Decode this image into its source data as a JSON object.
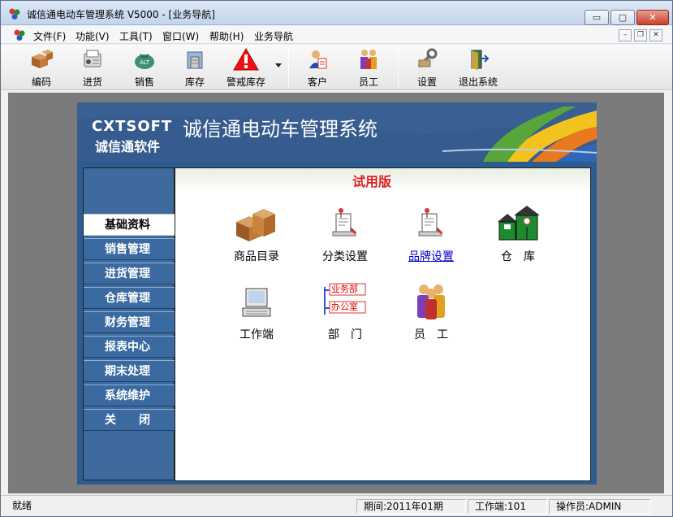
{
  "window": {
    "title": "诚信通电动车管理系统 V5000 - [业务导航]",
    "close_glyph": "✕",
    "minimize_glyph": "▭",
    "maximize_glyph": "▢"
  },
  "menubar": {
    "items": [
      "文件(F)",
      "功能(V)",
      "工具(T)",
      "窗口(W)",
      "帮助(H)",
      "业务导航"
    ],
    "mdi_min": "–",
    "mdi_restore": "❐",
    "mdi_close": "✕"
  },
  "toolbar": {
    "buttons": [
      {
        "label": "编码",
        "icon": "boxes-icon"
      },
      {
        "label": "进货",
        "icon": "stock-in-icon"
      },
      {
        "label": "销售",
        "icon": "money-bag-icon"
      },
      {
        "label": "库存",
        "icon": "warehouse-icon"
      },
      {
        "label": "警戒库存",
        "icon": "warning-icon"
      },
      {
        "label": "客户",
        "icon": "customer-icon"
      },
      {
        "label": "员工",
        "icon": "staff-icon"
      },
      {
        "label": "设置",
        "icon": "tools-icon"
      },
      {
        "label": "退出系统",
        "icon": "exit-door-icon"
      }
    ]
  },
  "banner": {
    "logo_en": "CXTSOFT",
    "logo_cn": "诚信通软件",
    "system_title": "诚信通电动车管理系统"
  },
  "nav": {
    "items": [
      "基础资料",
      "销售管理",
      "进货管理",
      "仓库管理",
      "财务管理",
      "报表中心",
      "期末处理",
      "系统维护",
      "关　　闭"
    ],
    "active_index": 0
  },
  "content": {
    "edition": "试用版",
    "items": [
      {
        "label": "商品目录",
        "icon": "product-catalog-icon"
      },
      {
        "label": "分类设置",
        "icon": "category-settings-icon"
      },
      {
        "label": "品牌设置",
        "icon": "brand-settings-icon"
      },
      {
        "label": "仓　库",
        "icon": "warehouse-houses-icon"
      },
      {
        "label": "工作端",
        "icon": "workstation-icon"
      },
      {
        "label": "部　门",
        "icon": "department-icon"
      },
      {
        "label": "员　工",
        "icon": "employees-icon"
      }
    ],
    "dept_chart": {
      "node1": "业务部",
      "node2": "办公室"
    }
  },
  "statusbar": {
    "status": "就绪",
    "period": "期间:2011年01期",
    "workstation": "工作端:101",
    "operator": "操作员:ADMIN"
  },
  "colors": {
    "nav_blue": "#3a6aa0",
    "banner_blue": "#3a5f93",
    "trial_red": "#dd2222",
    "link_blue": "#0000cc"
  }
}
